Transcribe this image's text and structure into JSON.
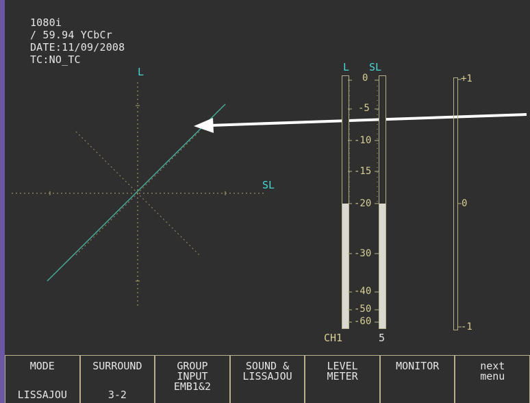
{
  "status": {
    "format": "1080i",
    "rate": "/ 59.94 YCbCr",
    "date": "DATE:11/09/2008",
    "tc": "TC:NO_TC"
  },
  "lissajous": {
    "l_label": "L",
    "sl_label": "SL"
  },
  "meter": {
    "channel_labels": [
      "L",
      "SL"
    ],
    "scale_labels": [
      "0",
      "-5",
      "-10",
      "-15",
      "-20",
      "-30",
      "-40",
      "-50",
      "-60"
    ],
    "bottom_left": "CH1",
    "bottom_right": "5",
    "levels": {
      "ch1": -20,
      "ch5": -20
    }
  },
  "correlation": {
    "top": "+1",
    "mid": "0",
    "bottom": "-1"
  },
  "menu": [
    {
      "line1": "MODE",
      "line2": "",
      "line3": "",
      "value": "LISSAJOU"
    },
    {
      "line1": "SURROUND",
      "line2": "",
      "line3": "",
      "value": "3-2"
    },
    {
      "line1": "GROUP",
      "line2": "INPUT",
      "line3": "EMB1&2",
      "value": ""
    },
    {
      "line1": "SOUND &",
      "line2": "LISSAJOU",
      "line3": "",
      "value": ""
    },
    {
      "line1": "LEVEL",
      "line2": "METER",
      "line3": "",
      "value": ""
    },
    {
      "line1": "MONITOR",
      "line2": "",
      "line3": "",
      "value": ""
    },
    {
      "line1": "next",
      "line2": "menu",
      "line3": "",
      "value": ""
    }
  ]
}
